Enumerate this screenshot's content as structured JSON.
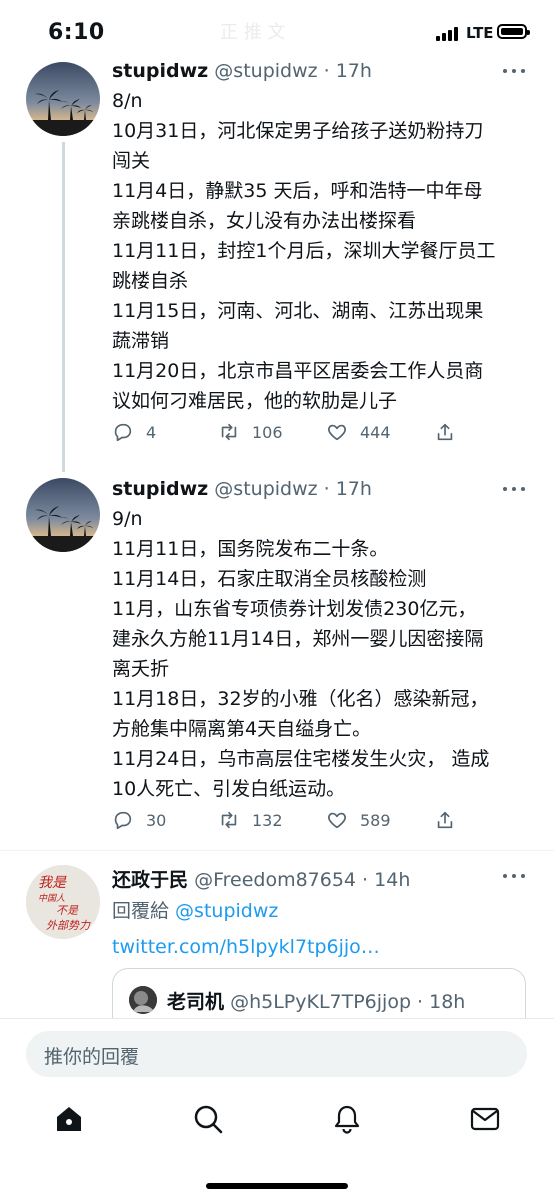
{
  "status_bar": {
    "time": "6:10",
    "network": "LTE"
  },
  "faded_header": "正 推 文",
  "tweets": [
    {
      "name": "stupidwz",
      "handle": "@stupidwz · 17h",
      "lines": [
        "8/n",
        "10月31日，河北保定男子给孩子送奶粉持刀",
        "闯关",
        "11月4日，静默35 天后，呼和浩特一中年母",
        "亲跳楼自杀，女儿没有办法出楼探看",
        "11月11日，封控1个月后，深圳大学餐厅员工",
        "跳楼自杀",
        "11月15日，河南、河北、湖南、江苏出现果",
        "蔬滞销",
        "11月20日，北京市昌平区居委会工作人员商",
        "议如何刁难居民，他的软肋是儿子"
      ],
      "replies": "4",
      "retweets": "106",
      "likes": "444"
    },
    {
      "name": "stupidwz",
      "handle": "@stupidwz · 17h",
      "lines": [
        "9/n",
        "11月11日，国务院发布二十条。",
        "11月14日，石家庄取消全员核酸检测",
        "11月，山东省专项债券计划发债230亿元，",
        "建永久方舱11月14日，郑州一婴儿因密接隔",
        "离夭折",
        "11月18日，32岁的小雅（化名）感染新冠，",
        "方舱集中隔离第4天自缢身亡。",
        "11月24日，乌市高层住宅楼发生火灾， 造成",
        "10人死亡、引发白纸运动。"
      ],
      "replies": "30",
      "retweets": "132",
      "likes": "589"
    }
  ],
  "reply_tweet": {
    "name": "还政于民",
    "handle": "@Freedom87654 · 14h",
    "reply_to_prefix": "回覆給 ",
    "reply_to_user": "@stupidwz",
    "link": "twitter.com/h5lpykl7tp6jjo…",
    "avatar_text": [
      "我是",
      "中国人",
      "不是",
      "外部势力"
    ],
    "quoted": {
      "name": "老司机",
      "handle": "@h5LPyKL7TP6jjop · 18h"
    }
  },
  "reply_bar": {
    "placeholder": "推你的回覆"
  },
  "tabs": [
    {
      "icon": "home-icon"
    },
    {
      "icon": "search-icon"
    },
    {
      "icon": "notifications-icon"
    },
    {
      "icon": "messages-icon"
    }
  ],
  "colors": {
    "link": "#1d9bf0",
    "secondary_text": "#536471",
    "thread_line": "#cfd9de"
  }
}
